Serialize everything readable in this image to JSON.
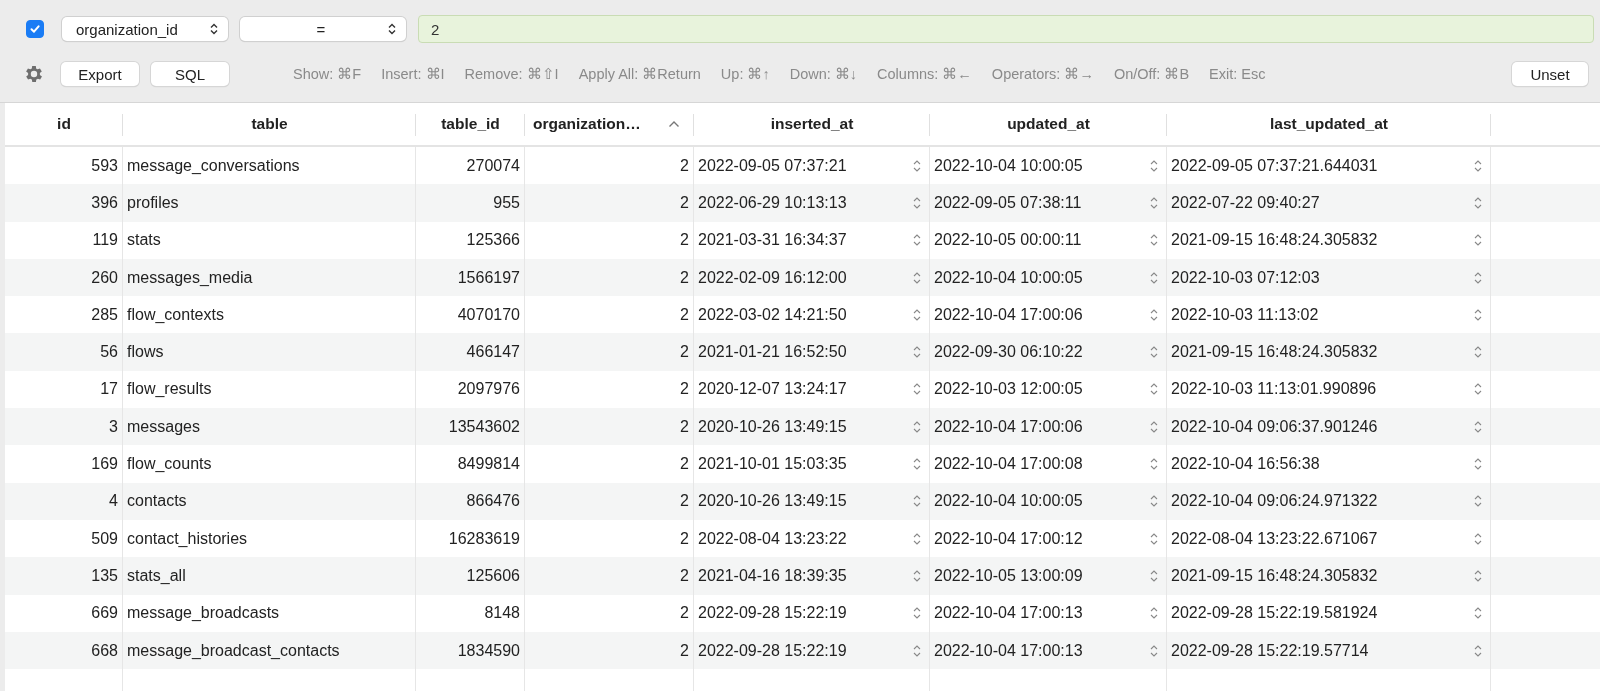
{
  "filter": {
    "enabled": true,
    "column": "organization_id",
    "operator": "=",
    "value": "2"
  },
  "toolbar": {
    "buttons": [
      "Export",
      "SQL"
    ],
    "shortcuts": [
      "Show: ⌘F",
      "Insert: ⌘I",
      "Remove: ⌘⇧I",
      "Apply All: ⌘Return",
      "Up: ⌘↑",
      "Down: ⌘↓",
      "Columns: ⌘←",
      "Operators: ⌘→",
      "On/Off: ⌘B",
      "Exit: Esc"
    ],
    "unset_button": "Unset"
  },
  "table": {
    "columns": [
      {
        "label": "id",
        "kind": "number",
        "sorted": false
      },
      {
        "label": "table",
        "kind": "text",
        "sorted": false
      },
      {
        "label": "table_id",
        "kind": "number",
        "sorted": false
      },
      {
        "label": "organization…",
        "kind": "number",
        "sorted": true
      },
      {
        "label": "inserted_at",
        "kind": "timestamp",
        "sorted": false
      },
      {
        "label": "updated_at",
        "kind": "timestamp",
        "sorted": false
      },
      {
        "label": "last_updated_at",
        "kind": "timestamp",
        "sorted": false
      }
    ],
    "rows": [
      [
        "593",
        "message_conversations",
        "270074",
        "2",
        "2022-09-05 07:37:21",
        "2022-10-04 10:00:05",
        "2022-09-05 07:37:21.644031"
      ],
      [
        "396",
        "profiles",
        "955",
        "2",
        "2022-06-29 10:13:13",
        "2022-09-05 07:38:11",
        "2022-07-22 09:40:27"
      ],
      [
        "119",
        "stats",
        "125366",
        "2",
        "2021-03-31 16:34:37",
        "2022-10-05 00:00:11",
        "2021-09-15 16:48:24.305832"
      ],
      [
        "260",
        "messages_media",
        "1566197",
        "2",
        "2022-02-09 16:12:00",
        "2022-10-04 10:00:05",
        "2022-10-03 07:12:03"
      ],
      [
        "285",
        "flow_contexts",
        "4070170",
        "2",
        "2022-03-02 14:21:50",
        "2022-10-04 17:00:06",
        "2022-10-03 11:13:02"
      ],
      [
        "56",
        "flows",
        "466147",
        "2",
        "2021-01-21 16:52:50",
        "2022-09-30 06:10:22",
        "2021-09-15 16:48:24.305832"
      ],
      [
        "17",
        "flow_results",
        "2097976",
        "2",
        "2020-12-07 13:24:17",
        "2022-10-03 12:00:05",
        "2022-10-03 11:13:01.990896"
      ],
      [
        "3",
        "messages",
        "13543602",
        "2",
        "2020-10-26 13:49:15",
        "2022-10-04 17:00:06",
        "2022-10-04 09:06:37.901246"
      ],
      [
        "169",
        "flow_counts",
        "8499814",
        "2",
        "2021-10-01 15:03:35",
        "2022-10-04 17:00:08",
        "2022-10-04 16:56:38"
      ],
      [
        "4",
        "contacts",
        "866476",
        "2",
        "2020-10-26 13:49:15",
        "2022-10-04 10:00:05",
        "2022-10-04 09:06:24.971322"
      ],
      [
        "509",
        "contact_histories",
        "16283619",
        "2",
        "2022-08-04 13:23:22",
        "2022-10-04 17:00:12",
        "2022-08-04 13:23:22.671067"
      ],
      [
        "135",
        "stats_all",
        "125606",
        "2",
        "2021-04-16 18:39:35",
        "2022-10-05 13:00:09",
        "2021-09-15 16:48:24.305832"
      ],
      [
        "669",
        "message_broadcasts",
        "8148",
        "2",
        "2022-09-28 15:22:19",
        "2022-10-04 17:00:13",
        "2022-09-28 15:22:19.581924"
      ],
      [
        "668",
        "message_broadcast_contacts",
        "1834590",
        "2",
        "2022-09-28 15:22:19",
        "2022-10-04 17:00:13",
        "2022-09-28 15:22:19.57714"
      ]
    ]
  }
}
